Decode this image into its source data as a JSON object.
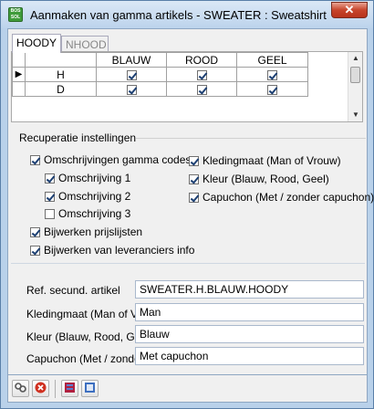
{
  "window": {
    "title": "Aanmaken van gamma artikels - SWEATER : Sweatshirt",
    "icon_text": "BOS SOL",
    "close_glyph": "✕"
  },
  "tabs": [
    {
      "label": "HOODY",
      "active": true
    },
    {
      "label": "NHOOD",
      "active": false
    }
  ],
  "grid": {
    "columns": [
      "BLAUW",
      "ROOD",
      "GEEL"
    ],
    "rows": [
      {
        "label": "H",
        "current": true,
        "values": [
          true,
          true,
          true
        ]
      },
      {
        "label": "D",
        "current": false,
        "values": [
          true,
          true,
          true
        ]
      }
    ],
    "current_row_glyph": "▶",
    "scroll_up_glyph": "▲",
    "scroll_down_glyph": "▼"
  },
  "recuperatie": {
    "group_title": "Recuperatie instellingen",
    "omschrijvingen": {
      "label": "Omschrijvingen gamma codes",
      "checked": true
    },
    "omschrijving1": {
      "label": "Omschrijving 1",
      "checked": true
    },
    "omschrijving2": {
      "label": "Omschrijving 2",
      "checked": true
    },
    "omschrijving3": {
      "label": "Omschrijving 3",
      "checked": false
    },
    "prijslijsten": {
      "label": "Bijwerken prijslijsten",
      "checked": true
    },
    "leveranciers": {
      "label": "Bijwerken van leveranciers info",
      "checked": true
    },
    "kledingmaat": {
      "label": "Kledingmaat (Man of Vrouw)",
      "checked": true
    },
    "kleur": {
      "label": "Kleur (Blauw, Rood, Geel)",
      "checked": true
    },
    "capuchon": {
      "label": "Capuchon (Met / zonder capuchon)",
      "checked": true
    }
  },
  "fields": {
    "ref": {
      "label": "Ref. secund. artikel",
      "value": "SWEATER.H.BLAUW.HOODY"
    },
    "kledingmaat": {
      "label": "Kledingmaat (Man of Vrouw)",
      "value": "Man"
    },
    "kleur": {
      "label": "Kleur (Blauw, Rood, Geel)",
      "value": "Blauw"
    },
    "capuchon": {
      "label": "Capuchon (Met / zonder capuchon)",
      "value": "Met capuchon"
    }
  },
  "toolbar": {
    "confirm_icon": "link-icon",
    "cancel_icon": "cancel-icon",
    "book1_icon": "book-icon",
    "book2_icon": "book-open-icon"
  }
}
